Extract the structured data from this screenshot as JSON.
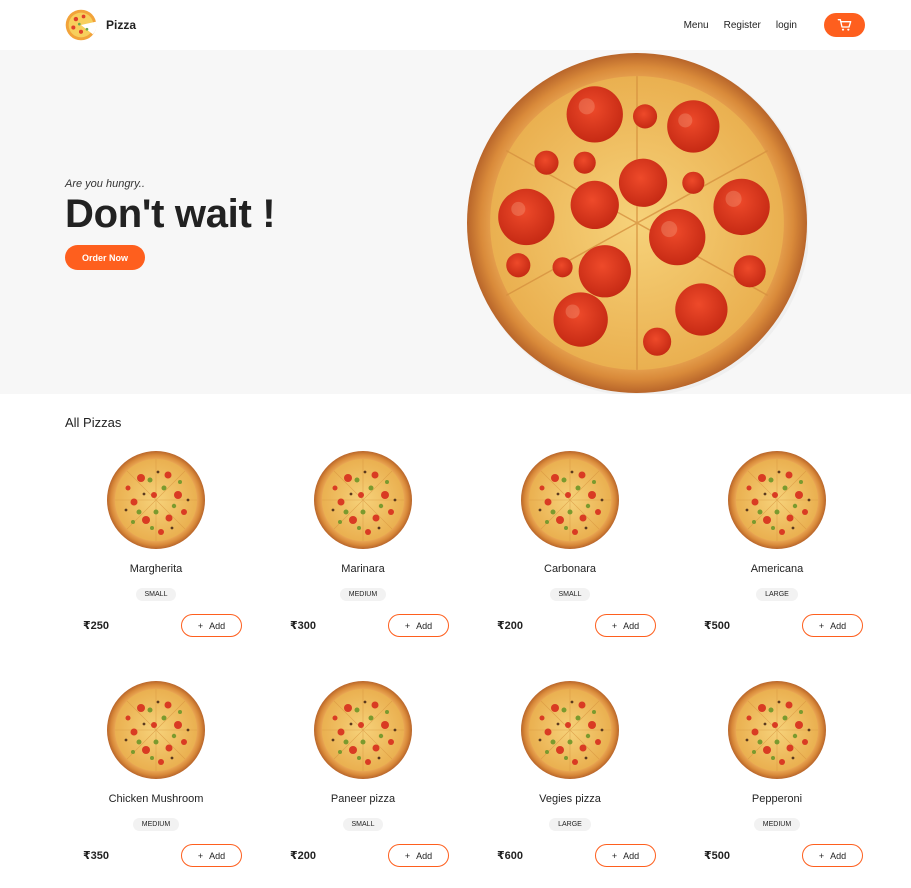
{
  "brand": {
    "name": "Pizza",
    "logo_icon": "pizza-logo-icon"
  },
  "nav": {
    "links": [
      "Menu",
      "Register",
      "login"
    ],
    "cart_icon": "cart-icon"
  },
  "hero": {
    "tagline": "Are you hungry..",
    "title": "Don't wait !",
    "cta_label": "Order Now"
  },
  "colors": {
    "accent": "#fe5f1e",
    "hero_bg": "#f7f7f7"
  },
  "menu": {
    "section_title": "All Pizzas",
    "add_label": "Add",
    "add_icon": "plus-icon",
    "items": [
      {
        "name": "Margherita",
        "size": "small",
        "price": "₹250"
      },
      {
        "name": "Marinara",
        "size": "medium",
        "price": "₹300"
      },
      {
        "name": "Carbonara",
        "size": "small",
        "price": "₹200"
      },
      {
        "name": "Americana",
        "size": "large",
        "price": "₹500"
      },
      {
        "name": "Chicken Mushroom",
        "size": "medium",
        "price": "₹350"
      },
      {
        "name": "Paneer pizza",
        "size": "small",
        "price": "₹200"
      },
      {
        "name": "Vegies pizza",
        "size": "large",
        "price": "₹600"
      },
      {
        "name": "Pepperoni",
        "size": "medium",
        "price": "₹500"
      }
    ]
  }
}
